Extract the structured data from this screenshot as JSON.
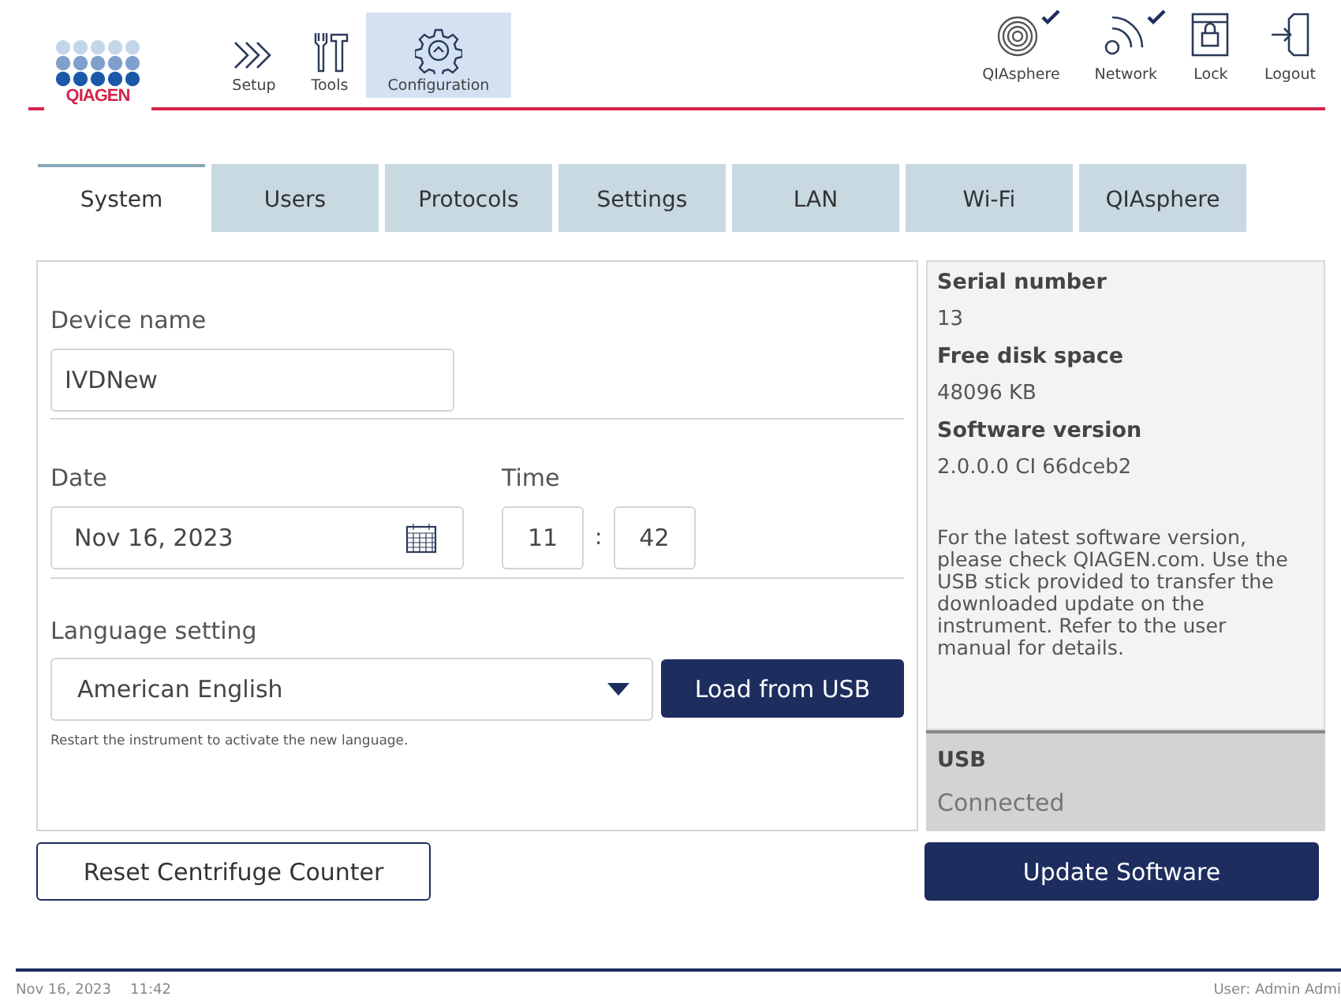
{
  "logo": {
    "text": "QIAGEN"
  },
  "nav": [
    {
      "label": "Setup",
      "selected": false
    },
    {
      "label": "Tools",
      "selected": false
    },
    {
      "label": "Configuration",
      "selected": true
    }
  ],
  "status": [
    {
      "label": "QIAsphere",
      "checked": true
    },
    {
      "label": "Network",
      "checked": true
    },
    {
      "label": "Lock",
      "checked": false
    },
    {
      "label": "Logout",
      "checked": false
    }
  ],
  "tabs": [
    {
      "label": "System",
      "selected": true
    },
    {
      "label": "Users",
      "selected": false
    },
    {
      "label": "Protocols",
      "selected": false
    },
    {
      "label": "Settings",
      "selected": false
    },
    {
      "label": "LAN",
      "selected": false
    },
    {
      "label": "Wi-Fi",
      "selected": false
    },
    {
      "label": "QIAsphere",
      "selected": false
    }
  ],
  "device_name": {
    "label": "Device name",
    "value": "IVDNew"
  },
  "date": {
    "label": "Date",
    "value": "Nov 16, 2023"
  },
  "time": {
    "label": "Time",
    "hours": "11",
    "separator": ":",
    "minutes": "42"
  },
  "language": {
    "label": "Language setting",
    "value": "American English",
    "button": "Load from USB",
    "hint": "Restart the instrument to activate the new language."
  },
  "info": [
    {
      "label": "Serial number",
      "value": "13"
    },
    {
      "label": "Free disk space",
      "value": "48096 KB"
    },
    {
      "label": "Software version",
      "value": "2.0.0.0 CI 66dceb2"
    }
  ],
  "note": "For the latest software version, please check QIAGEN.com. Use the USB stick provided to transfer the downloaded update on the instrument. Refer to the user manual for details.",
  "usb": {
    "label": "USB",
    "status": "Connected"
  },
  "buttons": {
    "reset": "Reset Centrifuge Counter",
    "update": "Update Software"
  },
  "status_bar": {
    "date": "Nov 16, 2023",
    "time": "11:42",
    "user": "User: Admin Admi"
  }
}
